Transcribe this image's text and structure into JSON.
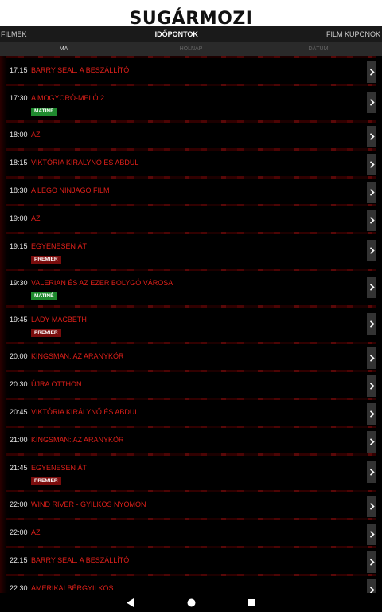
{
  "app": {
    "logo": "SUGÁRMOZI"
  },
  "nav": {
    "left": "FILMEK",
    "center": "IDŐPONTOK",
    "right": "FILM KUPONOK"
  },
  "subtabs": [
    "MA",
    "HOLNAP",
    "DÁTUM"
  ],
  "showtimes": [
    {
      "time": "17:15",
      "title": "BARRY SEAL: A BESZÁLLÍTÓ",
      "badge": ""
    },
    {
      "time": "17:30",
      "title": "A MOGYORÓ-MELÓ 2.",
      "badge": "MATINÉ"
    },
    {
      "time": "18:00",
      "title": "AZ",
      "badge": ""
    },
    {
      "time": "18:15",
      "title": "VIKTÓRIA KIRÁLYNŐ ÉS ABDUL",
      "badge": ""
    },
    {
      "time": "18:30",
      "title": "A LEGO NINJAGO FILM",
      "badge": ""
    },
    {
      "time": "19:00",
      "title": "AZ",
      "badge": ""
    },
    {
      "time": "19:15",
      "title": "EGYENESEN ÁT",
      "badge": "PREMIER"
    },
    {
      "time": "19:30",
      "title": "VALERIAN ÉS AZ EZER BOLYGÓ VÁROSA",
      "badge": "MATINÉ"
    },
    {
      "time": "19:45",
      "title": "LADY MACBETH",
      "badge": "PREMIER"
    },
    {
      "time": "20:00",
      "title": "KINGSMAN: AZ ARANYKÖR",
      "badge": ""
    },
    {
      "time": "20:30",
      "title": "ÚJRA OTTHON",
      "badge": ""
    },
    {
      "time": "20:45",
      "title": "VIKTÓRIA KIRÁLYNŐ ÉS ABDUL",
      "badge": ""
    },
    {
      "time": "21:00",
      "title": "KINGSMAN: AZ ARANYKÖR",
      "badge": ""
    },
    {
      "time": "21:45",
      "title": "EGYENESEN ÁT",
      "badge": "PREMIER"
    },
    {
      "time": "22:00",
      "title": "WIND RIVER - GYILKOS NYOMON",
      "badge": ""
    },
    {
      "time": "22:00",
      "title": "AZ",
      "badge": ""
    },
    {
      "time": "22:15",
      "title": "BARRY SEAL: A BESZÁLLÍTÓ",
      "badge": ""
    },
    {
      "time": "22:30",
      "title": "AMERIKAI BÉRGYILKOS",
      "badge": ""
    }
  ],
  "colors": {
    "accent": "#e0201a",
    "matine": "#1f8a2e",
    "premier": "#7a0d0d"
  },
  "icons": {
    "row_action": "chevron-right-icon",
    "back": "back-triangle-icon",
    "home": "home-circle-icon",
    "recents": "recents-square-icon"
  }
}
